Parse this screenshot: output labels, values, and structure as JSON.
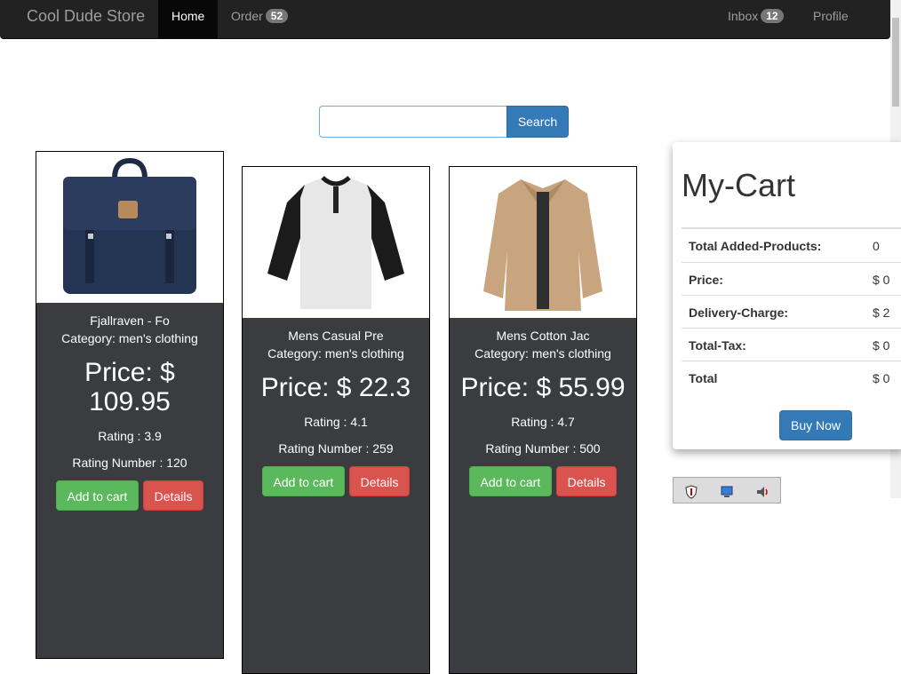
{
  "navbar": {
    "brand": "Cool Dude Store",
    "home": "Home",
    "order": "Order",
    "order_count": "52",
    "inbox": "Inbox",
    "inbox_count": "12",
    "profile": "Profile"
  },
  "search": {
    "value": "",
    "button": "Search"
  },
  "products": [
    {
      "name": "Fjallraven - Fo",
      "category": "Category: men's clothing",
      "price_line1": "Price: $",
      "price_line2": "109.95",
      "rating": "Rating : 3.9",
      "rating_number": "Rating Number : 120",
      "add": "Add to cart",
      "details": "Details",
      "image": "backpack-image"
    },
    {
      "name": "Mens Casual Pre",
      "category": "Category: men's clothing",
      "price": "Price: $ 22.3",
      "rating": "Rating : 4.1",
      "rating_number": "Rating Number : 259",
      "add": "Add to cart",
      "details": "Details",
      "image": "tshirt-image"
    },
    {
      "name": "Mens Cotton Jac",
      "category": "Category: men's clothing",
      "price": "Price: $ 55.99",
      "rating": "Rating : 4.7",
      "rating_number": "Rating Number : 500",
      "add": "Add to cart",
      "details": "Details",
      "image": "jacket-image"
    }
  ],
  "cart": {
    "title": "My-Cart",
    "rows": [
      {
        "label": "Total Added-Products:",
        "value": "0"
      },
      {
        "label": "Price:",
        "value": "$ 0"
      },
      {
        "label": "Delivery-Charge:",
        "value": "$ 2"
      },
      {
        "label": "Total-Tax:",
        "value": "$ 0"
      },
      {
        "label": "Total",
        "value": "$ 0"
      }
    ],
    "buy": "Buy Now"
  },
  "colors": {
    "navbar": "#222222",
    "primary": "#337ab7",
    "success": "#5cb85c",
    "danger": "#d9534f",
    "card_body": "#3a3c40"
  }
}
